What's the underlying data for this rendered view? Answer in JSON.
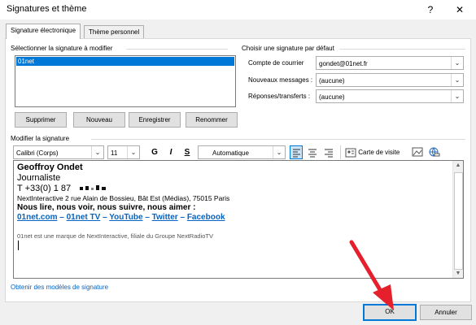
{
  "window": {
    "title": "Signatures et thème",
    "help_icon": "?",
    "close_icon": "✕"
  },
  "tabs": [
    {
      "label": "Signature électronique"
    },
    {
      "label": "Thème personnel"
    }
  ],
  "select_section": {
    "label": "Sélectionner la signature à modifier",
    "items": [
      "01net"
    ]
  },
  "signature_buttons": {
    "delete": "Supprimer",
    "new": "Nouveau",
    "save": "Enregistrer",
    "rename": "Renommer"
  },
  "default_section": {
    "label": "Choisir une signature par défaut",
    "account_label": "Compte de courrier",
    "account_value": "gondet@01net.fr",
    "new_messages_label": "Nouveaux messages :",
    "new_messages_value": "(aucune)",
    "replies_label": "Réponses/transferts :",
    "replies_value": "(aucune)"
  },
  "edit_section": {
    "label": "Modifier la signature"
  },
  "toolbar": {
    "font": "Calibri (Corps)",
    "size": "11",
    "bold": "G",
    "italic": "I",
    "underline": "S",
    "color": "Automatique",
    "business_card": "Carte de visite"
  },
  "signature": {
    "name": "Geoffroy Ondet",
    "role": "Journaliste",
    "phone": "T +33(0) 1 87",
    "address": "NextInteractive 2 rue Alain de Bossieu, Bât Est (Médias), 75015 Paris",
    "cta": "Nous lire, nous voir, nous suivre, nous aimer :",
    "links": [
      "01net.com",
      "01net TV",
      "YouTube",
      "Twitter",
      "Facebook"
    ],
    "link_separator": "–",
    "footer": "01net est une marque de NextInteractive, filiale du Groupe NextRadioTV"
  },
  "templates_link": "Obtenir des modèles de signature",
  "dialog_buttons": {
    "ok": "OK",
    "cancel": "Annuler"
  },
  "colors": {
    "accent": "#0078d7",
    "link": "#0563c1",
    "arrow": "#e5202c",
    "selection": "#0078d7"
  }
}
